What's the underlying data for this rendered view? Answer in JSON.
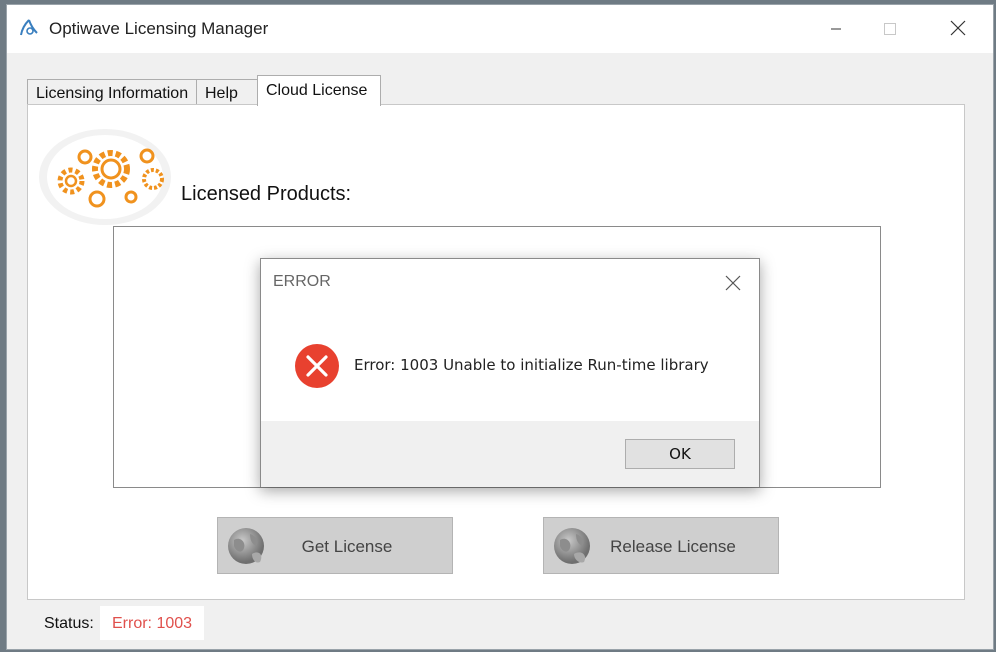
{
  "window": {
    "title": "Optiwave Licensing Manager"
  },
  "tabs": [
    {
      "label": "Licensing Information"
    },
    {
      "label": "Help"
    },
    {
      "label": "Cloud License"
    }
  ],
  "panel": {
    "licensed_products_label": "Licensed Products:",
    "get_license_label": "Get License",
    "release_license_label": "Release License"
  },
  "status": {
    "label": "Status:",
    "value": "Error: 1003"
  },
  "dialog": {
    "title": "ERROR",
    "message": "Error: 1003 Unable to initialize Run-time library",
    "ok_label": "OK"
  },
  "colors": {
    "gear_orange": "#f0921e",
    "error_red": "#e8412f",
    "status_error_text": "#e0504c"
  },
  "icons": {
    "app": "optiwave-logo-icon",
    "minimize": "minimize-icon",
    "maximize": "maximize-icon",
    "close": "close-icon",
    "gears": "gears-icon",
    "globe": "globe-icon",
    "error": "error-icon"
  }
}
